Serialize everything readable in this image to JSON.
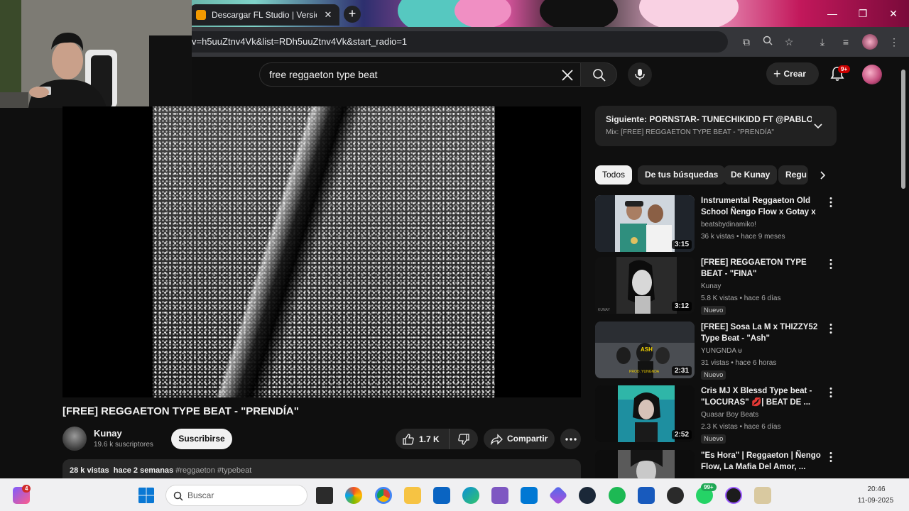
{
  "browser": {
    "tab_title": "Descargar FL Studio | Versión co",
    "url": "v=h5uuZtnv4Vk&list=RDh5uuZtnv4Vk&start_radio=1"
  },
  "youtube": {
    "search": {
      "value": "free reggaeton type beat"
    },
    "create_label": "Crear",
    "notifications_badge": "9+"
  },
  "video": {
    "title": "[FREE] REGGAETON TYPE BEAT - \"PRENDÍA\"",
    "channel": "Kunay",
    "subscribers": "19.6 k suscriptores",
    "subscribe_label": "Suscribirse",
    "likes": "1.7 K",
    "share_label": "Compartir",
    "views": "28 k vistas",
    "date": "hace 2 semanas",
    "tags": "#reggaeton #typebeat"
  },
  "playlist": {
    "next": "Siguiente: PORNSTAR- TUNECHIKIDD FT @PABLO...",
    "mix": "Mix: [FREE] REGGAETON TYPE BEAT - \"PRENDÍA\""
  },
  "chips": [
    "Todos",
    "De tus búsquedas",
    "De Kunay",
    "Regu"
  ],
  "recommendations": [
    {
      "title": "Instrumental Reggaeton Old School Ñengo Flow x Gotay x ...",
      "channel": "beatsbydinamiko!",
      "meta": "36 k vistas • hace 9 meses",
      "duration": "3:15",
      "badge": ""
    },
    {
      "title": "[FREE] REGGAETON TYPE BEAT - \"FINA\"",
      "channel": "Kunay",
      "meta": "5.8 K vistas • hace 6 días",
      "duration": "3:12",
      "badge": "Nuevo"
    },
    {
      "title": "[FREE] Sosa La M x THIZZY52 Type Beat - \"Ash\"",
      "channel": "YUNGNDA ᵾ",
      "meta": "31 vistas • hace 6 horas",
      "duration": "2:31",
      "badge": "Nuevo",
      "thumb_text": "ASH",
      "thumb_sub": "PROD. YUNGNDA"
    },
    {
      "title": "Cris MJ X Blessd Type beat - \"LOCURAS\" 💋| BEAT DE ...",
      "channel": "Quasar Boy Beats",
      "meta": "2.3 K vistas • hace 6 días",
      "duration": "2:52",
      "badge": "Nuevo"
    },
    {
      "title": "\"Es Hora\" | Reggaeton | Ñengo Flow, La Mafia Del Amor, ...",
      "channel": "",
      "meta": "",
      "duration": "",
      "badge": ""
    }
  ],
  "taskbar": {
    "search_placeholder": "Buscar",
    "time": "20:46",
    "date": "11-09-2025",
    "copilot_badge": "4",
    "whatsapp_badge": "99+"
  },
  "colors": {
    "accent_red": "#cc0000",
    "yt_bg": "#0f0f0f",
    "chip_bg": "#272727"
  }
}
